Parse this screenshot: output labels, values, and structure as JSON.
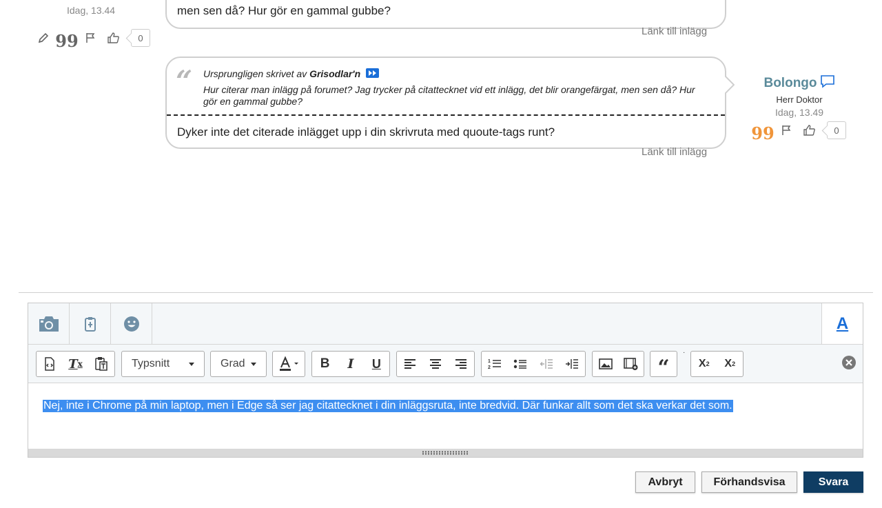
{
  "post1": {
    "date": "Idag, 13.44",
    "text": "men sen då? Hur gör en gammal gubbe?",
    "link": "Länk till inlägg",
    "like_count": "0"
  },
  "post2": {
    "quote": {
      "prefix": "Ursprungligen skrivet av ",
      "author": "Grisodlar'n",
      "text": "Hur citerar man inlägg på forumet? Jag trycker på citattecknet vid ett inlägg, det blir orangefärgat, men sen då? Hur gör en gammal gubbe?"
    },
    "text": "Dyker inte det citerade inlägget upp i din skrivruta med quoute-tags runt?",
    "link": "Länk till inlägg",
    "user": {
      "name": "Bolongo",
      "title": "Herr Doktor",
      "date": "Idag, 13.49"
    },
    "like_count": "0"
  },
  "editor": {
    "font_label": "Typsnitt",
    "size_label": "Grad",
    "content": "Nej, inte i Chrome på min laptop, men i Edge så ser jag citattecknet i din inläggsruta, inte bredvid. Där funkar allt som det ska verkar det som.",
    "font_toggle": "A"
  },
  "buttons": {
    "cancel": "Avbryt",
    "preview": "Förhandsvisa",
    "reply": "Svara"
  },
  "colors": {
    "accent": "#1a6ed8",
    "username": "#5a8a9a",
    "quote_active": "#f0953a",
    "primary_button": "#0f3d63",
    "selection": "#3d8ef0"
  }
}
